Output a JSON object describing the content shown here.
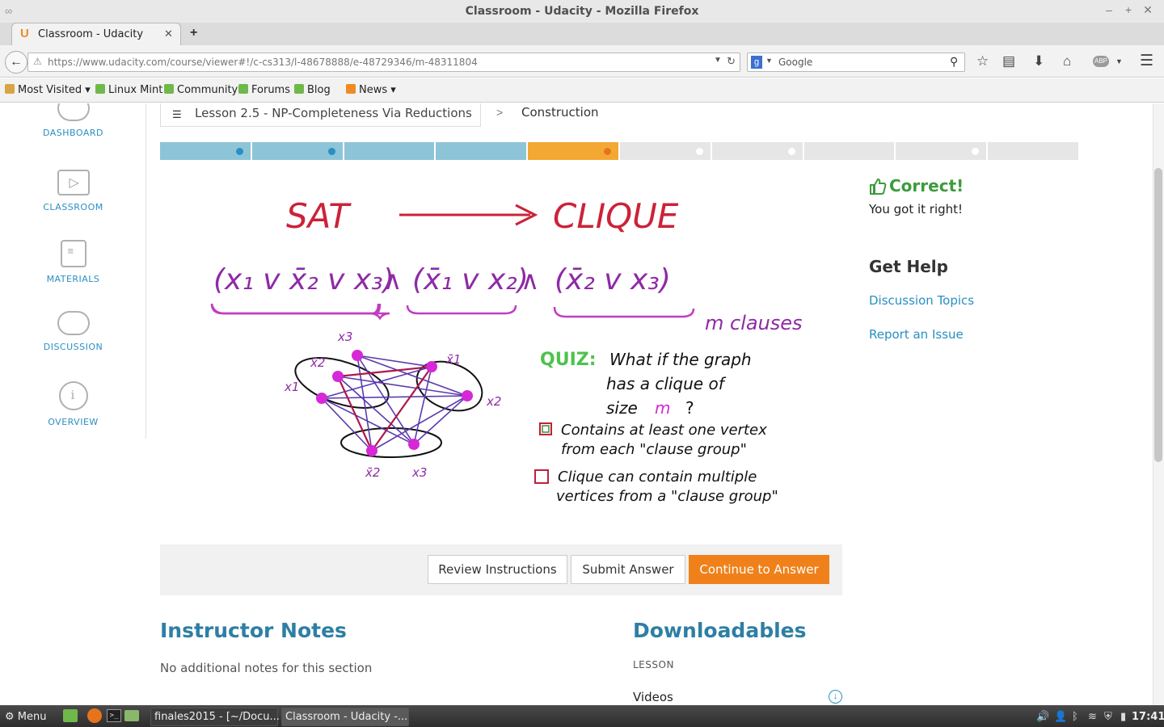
{
  "window": {
    "title": "Classroom - Udacity - Mozilla Firefox"
  },
  "tab": {
    "title": "Classroom - Udacity",
    "icon_letter": "U"
  },
  "nav": {
    "url": "https://www.udacity.com/course/viewer#!/c-cs313/l-48678888/e-48729346/m-48311804",
    "search_placeholder": "Google",
    "search_engine_letter": "g"
  },
  "bookmarks": [
    {
      "label": "Most Visited ▾"
    },
    {
      "label": "Linux Mint"
    },
    {
      "label": "Community"
    },
    {
      "label": "Forums"
    },
    {
      "label": "Blog"
    },
    {
      "label": "News ▾"
    }
  ],
  "sidebar": [
    {
      "label": "DASHBOARD"
    },
    {
      "label": "CLASSROOM"
    },
    {
      "label": "MATERIALS"
    },
    {
      "label": "DISCUSSION"
    },
    {
      "label": "OVERVIEW"
    }
  ],
  "breadcrumb": {
    "lesson": "Lesson 2.5 - NP-Completeness Via Reductions",
    "separator": ">",
    "current": "Construction"
  },
  "progress": {
    "segments": [
      {
        "state": "done",
        "dot": true
      },
      {
        "state": "done",
        "dot": true
      },
      {
        "state": "done",
        "dot": false
      },
      {
        "state": "done",
        "dot": false
      },
      {
        "state": "current",
        "dot": true
      },
      {
        "state": "todo",
        "dot": true
      },
      {
        "state": "todo",
        "dot": true
      },
      {
        "state": "todo",
        "dot": false
      },
      {
        "state": "todo",
        "dot": true
      },
      {
        "state": "todo",
        "dot": false
      }
    ],
    "colors": {
      "done": "#8ec4d8",
      "current": "#f3a833",
      "todo": "#e6e6e6",
      "done_dot": "#2a8fc3",
      "current_dot": "#e8731c",
      "todo_dot": "#ffffff"
    }
  },
  "whiteboard": {
    "title_left": "SAT",
    "title_right": "CLIQUE",
    "formula_c1": "(x₁ v x̄₂ v x₃)",
    "formula_c2": "(x̄₁ v x₂)",
    "formula_c3": "(x̄₂ v x₃)",
    "and_symbol": "∧",
    "m_clauses": "m clauses",
    "quiz_label": "QUIZ:",
    "quiz_q1": "What if the graph",
    "quiz_q2": "has a clique of",
    "quiz_q3": "size",
    "quiz_m": "m",
    "quiz_q": "?",
    "option1_l1": "Contains at least one vertex",
    "option1_l2": "from each \"clause group\"",
    "option1_checked": true,
    "option2_l1": "Clique can contain multiple",
    "option2_l2": "vertices from a \"clause group\"",
    "option2_checked": false,
    "node_labels": {
      "x3_top": "x3",
      "x2bar_a": "x̄2",
      "x1bar": "x̄1",
      "x1": "x1",
      "x2": "x2",
      "x2bar_b": "x̄2",
      "x3_b": "x3"
    }
  },
  "buttons": {
    "review": "Review Instructions",
    "submit": "Submit Answer",
    "continue": "Continue to Answer"
  },
  "result": {
    "title": "Correct!",
    "subtitle": "You got it right!"
  },
  "help": {
    "title": "Get Help",
    "links": [
      "Discussion Topics",
      "Report an Issue"
    ]
  },
  "notes": {
    "title": "Instructor Notes",
    "text": "No additional notes for this section"
  },
  "downloads": {
    "title": "Downloadables",
    "section": "LESSON",
    "item": "Videos"
  },
  "taskbar": {
    "menu": "Menu",
    "windows": [
      "finales2015 - [~/Docu...",
      "Classroom - Udacity -..."
    ],
    "clock": "17:41"
  }
}
